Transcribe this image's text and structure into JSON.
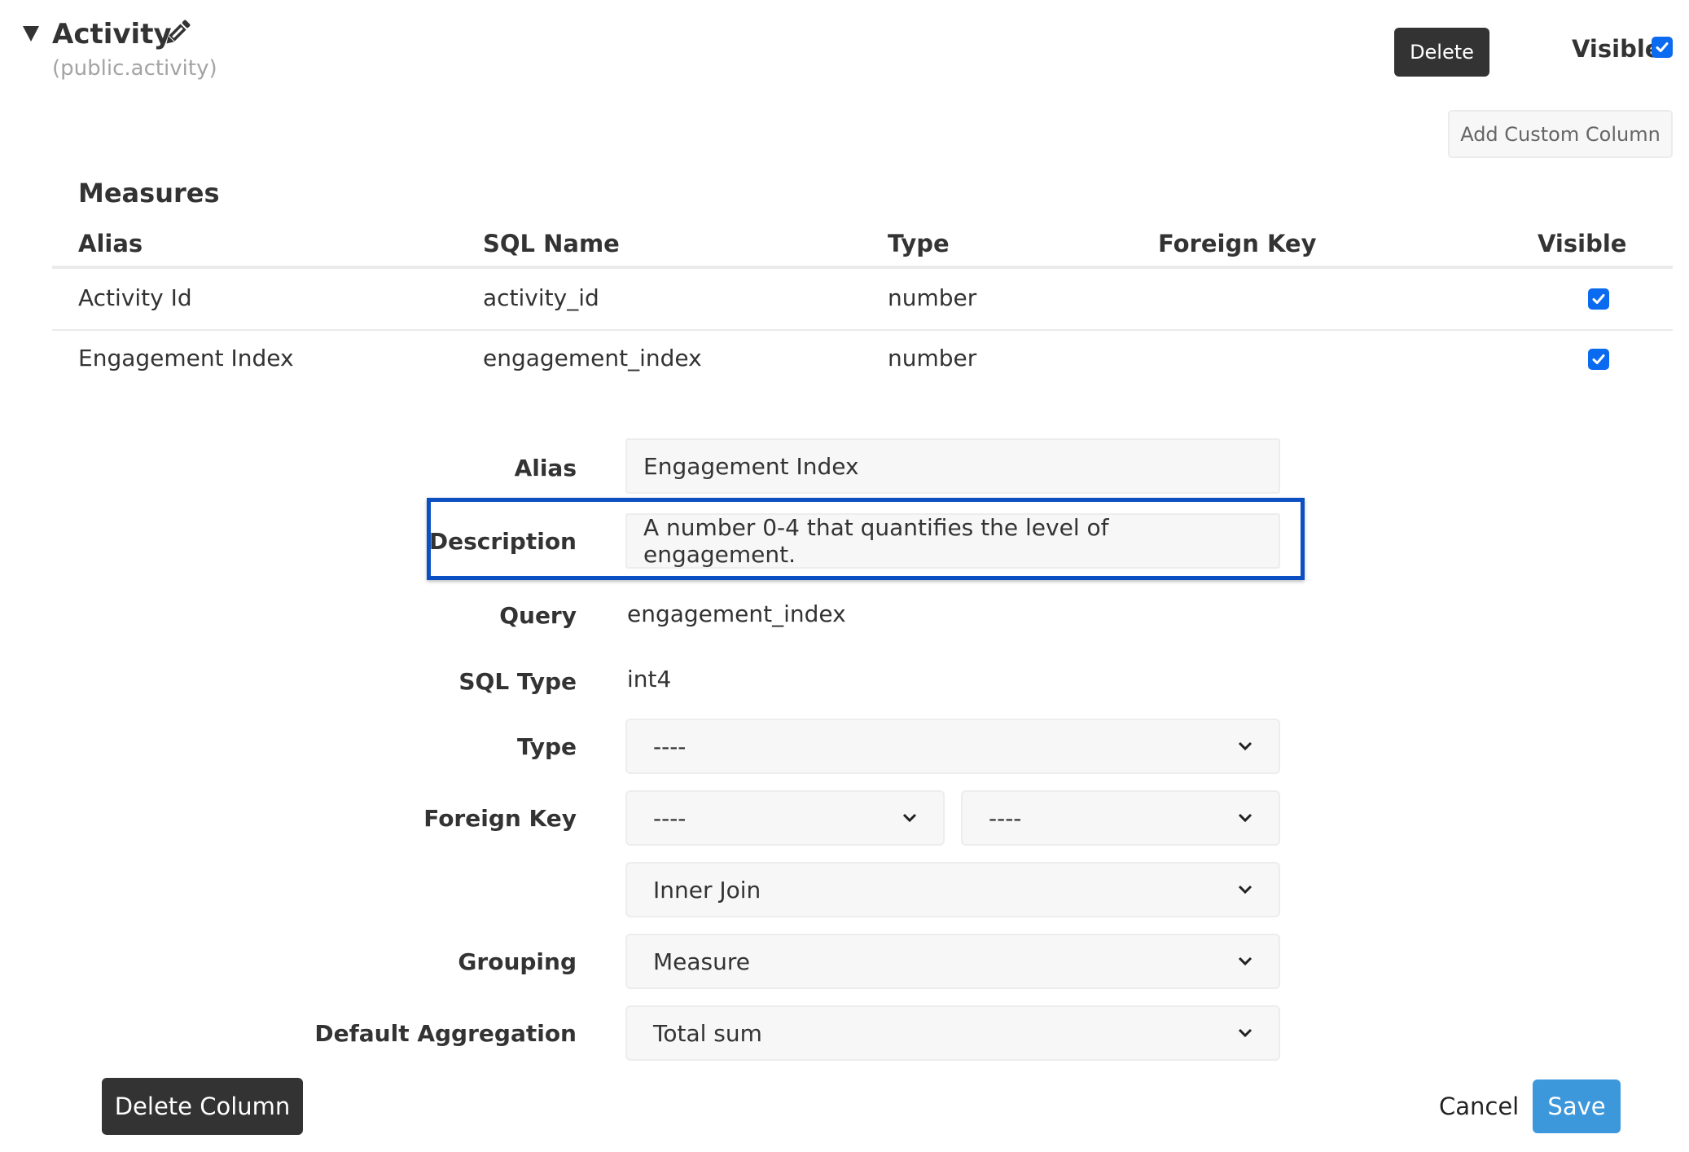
{
  "header": {
    "title": "Activity",
    "subtitle": "(public.activity)",
    "expand_icon": "triangle-down-icon",
    "edit_icon": "pencil-icon",
    "delete_label": "Delete",
    "visible_label": "Visible",
    "visible_checked": true,
    "add_custom_column_label": "Add Custom Column"
  },
  "measures": {
    "title": "Measures",
    "columns": [
      "Alias",
      "SQL Name",
      "Type",
      "Foreign Key",
      "Visible"
    ],
    "rows": [
      {
        "alias": "Activity Id",
        "sql_name": "activity_id",
        "type": "number",
        "foreign_key": "",
        "visible": true
      },
      {
        "alias": "Engagement Index",
        "sql_name": "engagement_index",
        "type": "number",
        "foreign_key": "",
        "visible": true
      }
    ]
  },
  "form": {
    "alias_label": "Alias",
    "alias_value": "Engagement Index",
    "description_label": "Description",
    "description_value": "A number 0-4 that quantifies the level of engagement.",
    "query_label": "Query",
    "query_value": "engagement_index",
    "sql_type_label": "SQL Type",
    "sql_type_value": "int4",
    "type_label": "Type",
    "type_value": "----",
    "foreign_key_label": "Foreign Key",
    "foreign_key_table_value": "----",
    "foreign_key_column_value": "----",
    "join_value": "Inner Join",
    "grouping_label": "Grouping",
    "grouping_value": "Measure",
    "default_aggregation_label": "Default Aggregation",
    "default_aggregation_value": "Total sum"
  },
  "footer": {
    "delete_column_label": "Delete Column",
    "cancel_label": "Cancel",
    "save_label": "Save"
  },
  "colors": {
    "accent": "#3d97db",
    "checkbox": "#0b6bf0",
    "highlight_border": "#0b4fc2",
    "dark_button": "#333333"
  }
}
